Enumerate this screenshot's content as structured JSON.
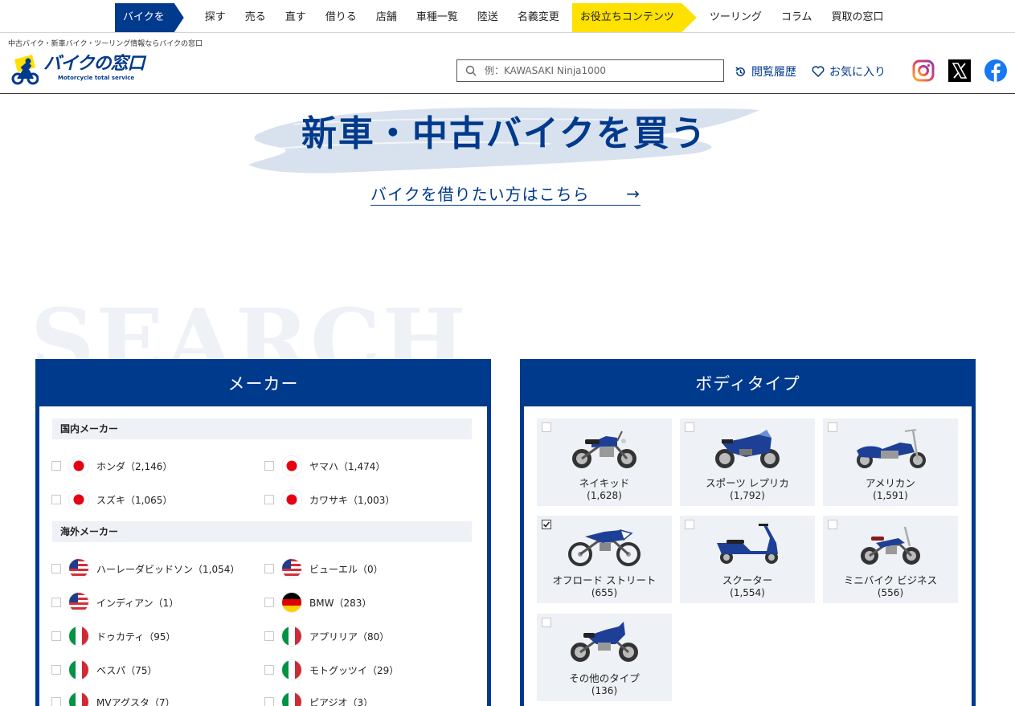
{
  "nav": {
    "items": [
      "バイクを",
      "探す",
      "売る",
      "直す",
      "借りる",
      "店舗",
      "車種一覧",
      "陸送",
      "名義変更",
      "お役立ちコンテンツ",
      "ツーリング",
      "コラム",
      "買取の窓口"
    ]
  },
  "header": {
    "tagline": "中古バイク・新車バイク・ツーリング情報ならバイクの窓口",
    "logo_main": "バイクの窓口",
    "logo_sub": "Motorcycle total service",
    "search_placeholder": "例：KAWASAKI Ninja1000",
    "history_label": "閲覧履歴",
    "favorite_label": "お気に入り",
    "social_icons": [
      "instagram-icon",
      "x-icon",
      "facebook-icon"
    ]
  },
  "hero": {
    "title": "新車・中古バイクを買う",
    "rent_link": "バイクを借りたい方はこちら",
    "rent_arrow": "→",
    "bg_word": "SEARCH"
  },
  "maker": {
    "title": "メーカー",
    "domestic_head": "国内メーカー",
    "overseas_head": "海外メーカー",
    "domestic": [
      {
        "label": "ホンダ（2,146）",
        "flag": "jp"
      },
      {
        "label": "ヤマハ（1,474）",
        "flag": "jp"
      },
      {
        "label": "スズキ（1,065）",
        "flag": "jp"
      },
      {
        "label": "カワサキ（1,003）",
        "flag": "jp"
      }
    ],
    "overseas": [
      {
        "label": "ハーレーダビッドソン（1,054）",
        "flag": "us"
      },
      {
        "label": "ビューエル（0）",
        "flag": "us"
      },
      {
        "label": "インディアン（1）",
        "flag": "us"
      },
      {
        "label": "BMW（283）",
        "flag": "de"
      },
      {
        "label": "ドゥカティ（95）",
        "flag": "it"
      },
      {
        "label": "アプリリア（80）",
        "flag": "it"
      },
      {
        "label": "ベスパ（75）",
        "flag": "it"
      },
      {
        "label": "モトグッツイ（29）",
        "flag": "it"
      },
      {
        "label": "MVアグスタ（7）",
        "flag": "it"
      },
      {
        "label": "ピアジオ（3）",
        "flag": "it"
      }
    ]
  },
  "bodytype": {
    "title": "ボディタイプ",
    "items": [
      {
        "name": "ネイキッド",
        "count": "(1,628)",
        "checked": false
      },
      {
        "name": "スポーツ レプリカ",
        "count": "(1,792)",
        "checked": false
      },
      {
        "name": "アメリカン",
        "count": "(1,591)",
        "checked": false
      },
      {
        "name": "オフロード ストリート",
        "count": "(655)",
        "checked": true
      },
      {
        "name": "スクーター",
        "count": "(1,554)",
        "checked": false
      },
      {
        "name": "ミニバイク ビジネス",
        "count": "(556)",
        "checked": false
      },
      {
        "name": "その他のタイプ",
        "count": "(136)",
        "checked": false
      }
    ]
  },
  "colors": {
    "brand_blue": "#003a8c",
    "highlight_yellow": "#ffe100",
    "panel_bg": "#eef1f5"
  }
}
